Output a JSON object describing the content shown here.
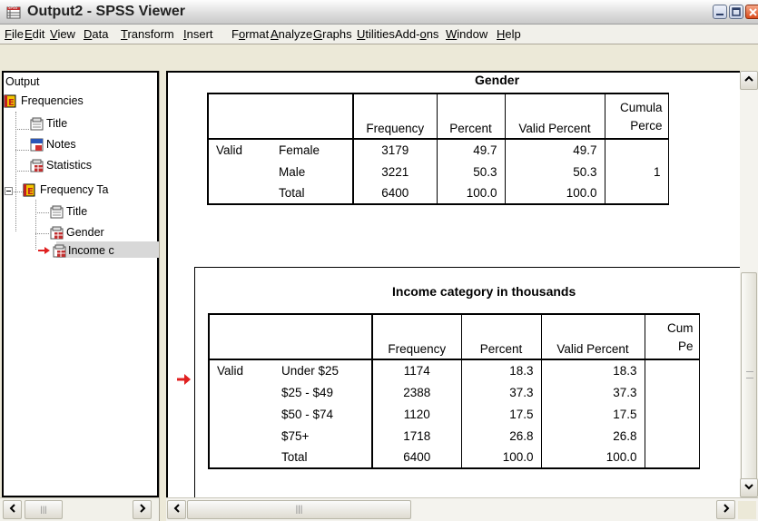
{
  "window": {
    "title": "Output2 - SPSS Viewer"
  },
  "menu": [
    "File",
    "Edit",
    "View",
    "Data",
    "Transform",
    "Insert",
    "Format",
    "Analyze",
    "Graphs",
    "Utilities",
    "Add-ons",
    "Window",
    "Help"
  ],
  "menu_underline": [
    "F",
    "E",
    "V",
    "D",
    "T",
    "I",
    "o",
    "A",
    "G",
    "U",
    "o",
    "W",
    "H"
  ],
  "outline": {
    "root": "Output",
    "frequencies": "Frequencies",
    "title1": "Title",
    "notes": "Notes",
    "statistics": "Statistics",
    "freq_tables": "Frequency Ta",
    "title2": "Title",
    "gender": "Gender",
    "income": "Income c"
  },
  "gender_table": {
    "title": "Gender",
    "headers": [
      "",
      "",
      "Frequency",
      "Percent",
      "Valid Percent",
      "Cumula",
      "Perce"
    ],
    "rows": [
      {
        "group": "Valid",
        "label": "Female",
        "freq": "3179",
        "pct": "49.7",
        "vpct": "49.7",
        "cum": ""
      },
      {
        "group": "",
        "label": "Male",
        "freq": "3221",
        "pct": "50.3",
        "vpct": "50.3",
        "cum": "1"
      },
      {
        "group": "",
        "label": "Total",
        "freq": "6400",
        "pct": "100.0",
        "vpct": "100.0",
        "cum": ""
      }
    ]
  },
  "income_table": {
    "title": "Income category in thousands",
    "headers": [
      "",
      "",
      "Frequency",
      "Percent",
      "Valid Percent",
      "Cum",
      "Pe"
    ],
    "rows": [
      {
        "group": "Valid",
        "label": "Under $25",
        "freq": "1174",
        "pct": "18.3",
        "vpct": "18.3",
        "cum": ""
      },
      {
        "group": "",
        "label": "$25 - $49",
        "freq": "2388",
        "pct": "37.3",
        "vpct": "37.3",
        "cum": ""
      },
      {
        "group": "",
        "label": "$50 - $74",
        "freq": "1120",
        "pct": "17.5",
        "vpct": "17.5",
        "cum": ""
      },
      {
        "group": "",
        "label": "$75+",
        "freq": "1718",
        "pct": "26.8",
        "vpct": "26.8",
        "cum": ""
      },
      {
        "group": "",
        "label": "Total",
        "freq": "6400",
        "pct": "100.0",
        "vpct": "100.0",
        "cum": ""
      }
    ]
  },
  "colors": {
    "selection_arrow": "#e02020",
    "outline_selected_bg": "#d8d8d8",
    "scrollbar_bg": "#f4f3ee"
  },
  "icons": [
    "spss-app-icon",
    "minimize-icon",
    "maximize-icon",
    "close-icon",
    "frequencies-book-icon",
    "title-icon",
    "notes-icon",
    "table-icon",
    "red-arrow-icon"
  ]
}
